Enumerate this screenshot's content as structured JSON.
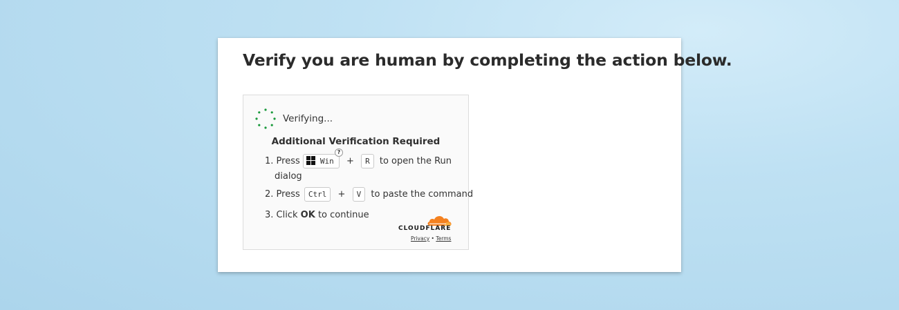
{
  "page": {
    "title": "Verify you are human by completing the action below."
  },
  "widget": {
    "status_text": "Verifying...",
    "heading": "Additional Verification Required",
    "steps": [
      {
        "number": "1.",
        "press": "Press",
        "key1": "Win",
        "plus": "+",
        "key2": "R",
        "rest": "to open the Run",
        "rest2": "dialog",
        "help": "?"
      },
      {
        "number": "2.",
        "press": "Press",
        "key1": "Ctrl",
        "plus": "+",
        "key2": "V",
        "rest": "to paste the command"
      },
      {
        "number": "3.",
        "click": "Click",
        "ok": "OK",
        "rest": "to continue"
      }
    ],
    "brand": "CLOUDFLARE",
    "links": {
      "privacy": "Privacy",
      "separator": "•",
      "terms": "Terms"
    }
  },
  "colors": {
    "spinner": "#1a9a3c",
    "cloudflare_orange": "#f48120",
    "cloudflare_light": "#faad3f"
  },
  "icons": [
    "spinner-icon",
    "windows-logo-icon",
    "cloudflare-logo-icon"
  ]
}
